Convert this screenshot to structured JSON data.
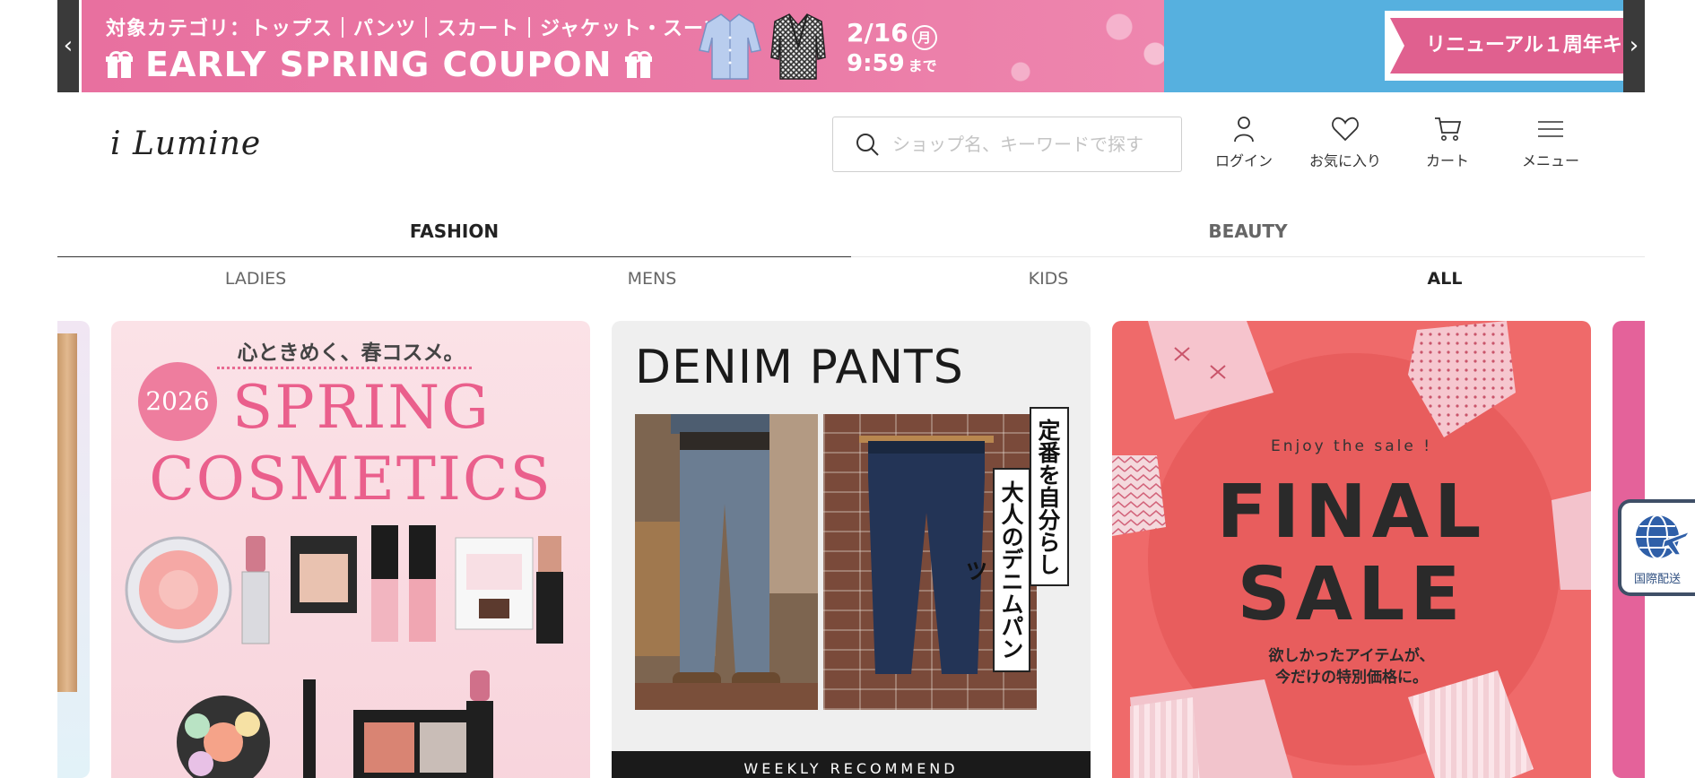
{
  "promo": {
    "categories_text": "対象カテゴリ：トップス｜パンツ｜スカート｜ジャケット・スーツ",
    "title": "EARLY SPRING COUPON",
    "date_main": "2/16",
    "date_dow": "月",
    "date_time": "9:59",
    "date_until": "まで",
    "next_slide_text": "リニューアル１周年キ",
    "prev_arrow": "‹",
    "next_arrow": "›",
    "colors": {
      "pink": "#e8709f",
      "blue": "#56b0df"
    }
  },
  "header": {
    "logo_text": "i Lumine",
    "search_placeholder": "ショップ名、キーワードで探す",
    "login_label": "ログイン",
    "favorites_label": "お気に入り",
    "cart_label": "カート",
    "menu_label": "メニュー"
  },
  "tabs": {
    "fashion": "FASHION",
    "beauty": "BEAUTY"
  },
  "subtabs": [
    "LADIES",
    "MENS",
    "KIDS",
    "ALL"
  ],
  "banners": {
    "spring": {
      "kicker": "心ときめく、春コスメ。",
      "year": "2026",
      "title_line1": "SPRING",
      "title_line2": "COSMETICS"
    },
    "denim": {
      "title": "DENIM PANTS",
      "vertical1": "定番を自分らしく",
      "vertical2": "大人のデニムパンツ",
      "bottom_bar": "WEEKLY RECOMMEND"
    },
    "sale": {
      "kicker": "Enjoy the sale !",
      "title_line1": "FINAL",
      "title_line2": "SALE",
      "sub_line1": "欲しかったアイテムが、",
      "sub_line2": "今だけの特別価格に。"
    }
  },
  "intl_shipping": {
    "label": "国際配送",
    "icon": "globe-plane-icon"
  }
}
